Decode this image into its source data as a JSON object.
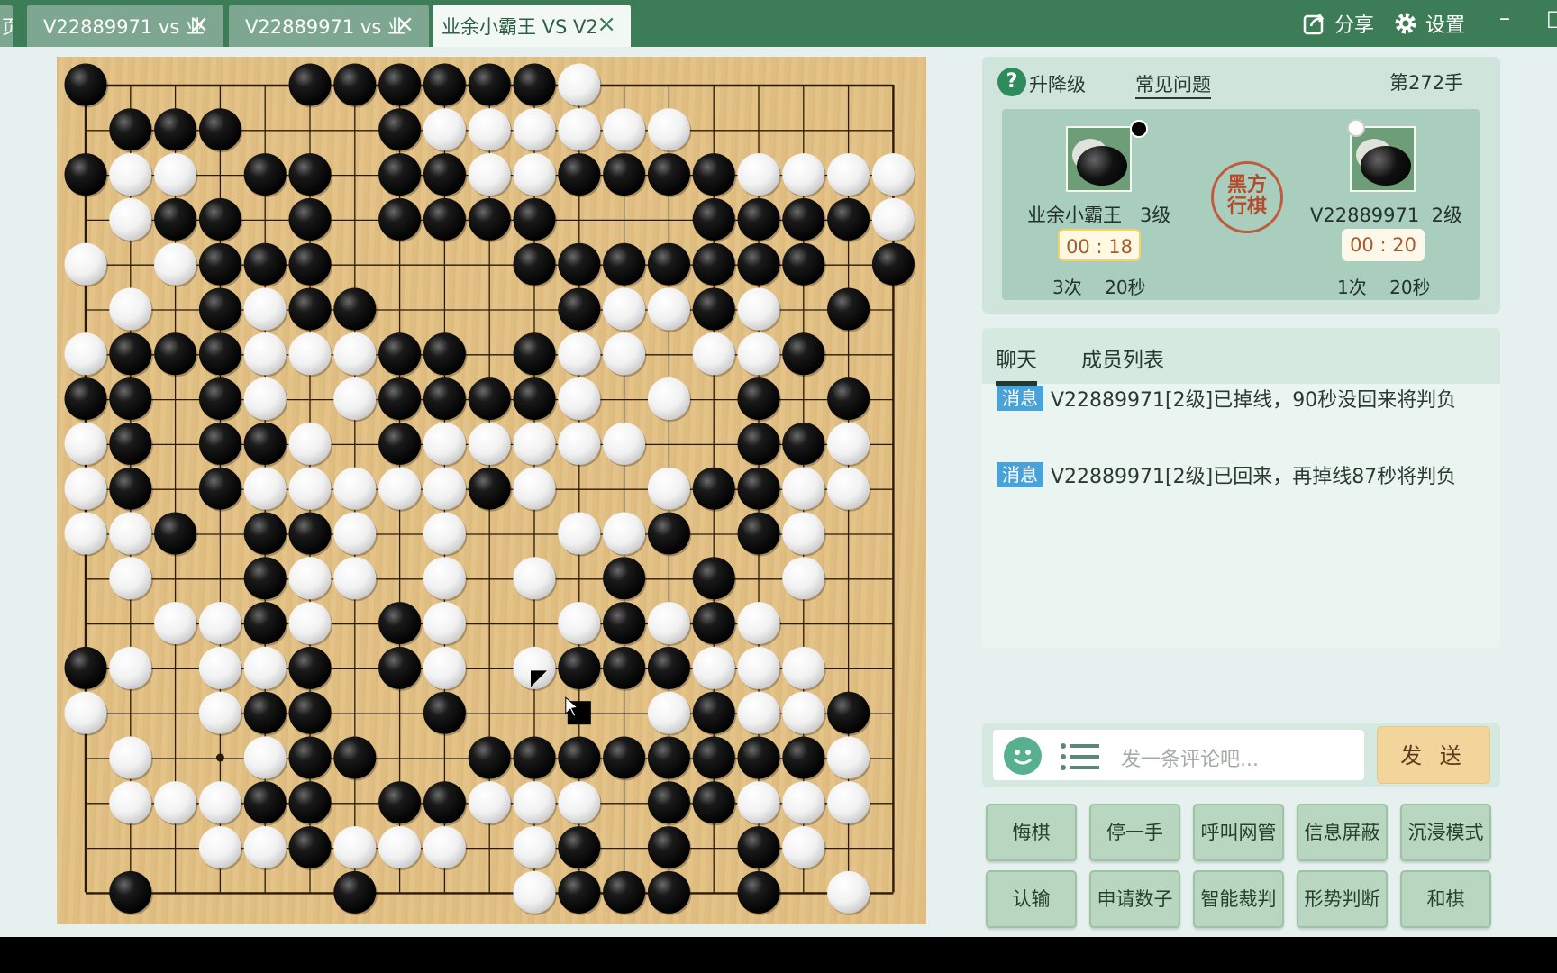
{
  "tabs": [
    {
      "label": "页",
      "closable": false
    },
    {
      "label": "V22889971 vs 业",
      "closable": true
    },
    {
      "label": "V22889971 vs 业",
      "closable": true
    },
    {
      "label": "业余小霸王 VS V2",
      "closable": true,
      "active": true
    }
  ],
  "top_actions": {
    "share": "分享",
    "settings": "设置",
    "minimize": "–",
    "maximize": "□"
  },
  "info": {
    "upgrade": "升降级",
    "faq": "常见问题",
    "move_count": "第272手",
    "turn": "黑方\n行棋",
    "black_player": {
      "name": "业余小霸王",
      "rank": "3级",
      "timer": "00 : 18",
      "byoyomi_count": "3次",
      "byoyomi_time": "20秒"
    },
    "white_player": {
      "name": "V22889971",
      "rank": "2级",
      "timer": "00 : 20",
      "byoyomi_count": "1次",
      "byoyomi_time": "20秒"
    }
  },
  "chat": {
    "tabs": [
      "聊天",
      "成员列表"
    ],
    "messages": [
      {
        "badge": "消息",
        "text": "V22889971[2级]已掉线，90秒没回来将判负"
      },
      {
        "badge": "消息",
        "text": "V22889971[2级]已回来，再掉线87秒将判负"
      }
    ],
    "input_placeholder": "发一条评论吧...",
    "send": "发 送"
  },
  "actions": [
    "悔棋",
    "停一手",
    "呼叫网管",
    "信息屏蔽",
    "沉浸模式",
    "认输",
    "申请数子",
    "智能裁判",
    "形势判断",
    "和棋"
  ],
  "board": {
    "size": 19,
    "rows": [
      "BxxxxBBBBBBWxxxxxxx",
      "xBBBxxxBWWWWWWxxxxx",
      "BWWxBBxBBWWBBBBWWWW",
      "xWBBxBxBBBBxxxBBBBW",
      "WxWBBBxxxxBBBBBBBxB",
      "xWxBWBBxxxxBWWBWxBx",
      "WBBBWWWBBxBWWxWWBxx",
      "BBxBWxWBBBBWxWxBxBx",
      "WBxBBWxBWWWWWxxBBWx",
      "WBxBWWWWWBWxxWBBWWx",
      "WWBxBBWxWxxWWBxBWxx",
      "xWxxBWWxWxWxBxBxWxx",
      "xxWWBWxBWxxWBWBWxxx",
      "BWxWWBxBWxWBBBWWWxx",
      "WxxWBBxxBxxxxWBWWBx",
      "xWxxWBBxxBBBBBBBBWx",
      "xWWWBBxBBWWWxBBWWWx",
      "xxxWWBWWWxWBxBxBWxx",
      "xBxxxxBxxxWBBBxBxWx"
    ],
    "last_move": [
      13,
      10
    ],
    "cursor_marker": [
      14,
      11
    ]
  }
}
